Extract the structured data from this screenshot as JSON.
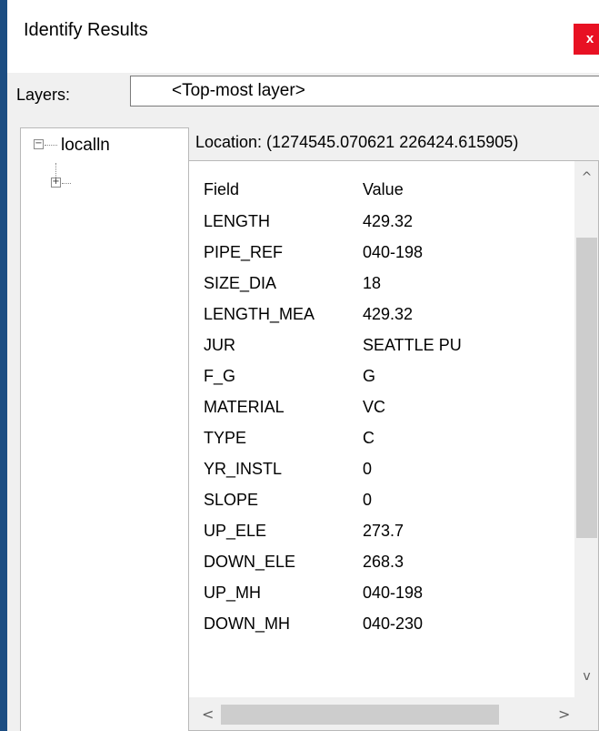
{
  "window": {
    "title": "Identify Results",
    "close_label": "x"
  },
  "layers": {
    "label": "Layers:",
    "selected": "<Top-most layer>"
  },
  "tree": {
    "root_label": "localln",
    "root_toggle": "−",
    "child_toggle": "+"
  },
  "location": "Location: (1274545.070621 226424.615905)",
  "table": {
    "headers": {
      "field": "Field",
      "value": "Value"
    },
    "rows": [
      {
        "field": "LENGTH",
        "value": "429.32"
      },
      {
        "field": "PIPE_REF",
        "value": "040-198"
      },
      {
        "field": "SIZE_DIA",
        "value": "18"
      },
      {
        "field": "LENGTH_MEA",
        "value": "429.32"
      },
      {
        "field": "JUR",
        "value": "SEATTLE PU"
      },
      {
        "field": "F_G",
        "value": "G"
      },
      {
        "field": "MATERIAL",
        "value": "VC"
      },
      {
        "field": "TYPE",
        "value": "C"
      },
      {
        "field": "YR_INSTL",
        "value": "0"
      },
      {
        "field": "SLOPE",
        "value": "0"
      },
      {
        "field": "UP_ELE",
        "value": "273.7"
      },
      {
        "field": "DOWN_ELE",
        "value": "268.3"
      },
      {
        "field": "UP_MH",
        "value": "040-198"
      },
      {
        "field": "DOWN_MH",
        "value": "040-230"
      }
    ]
  },
  "scroll": {
    "up_arrow": "^",
    "down_arrow": "v",
    "left_arrow": "<",
    "right_arrow": ">"
  },
  "colors": {
    "background": "#1c4d82",
    "close_button": "#e81123"
  }
}
